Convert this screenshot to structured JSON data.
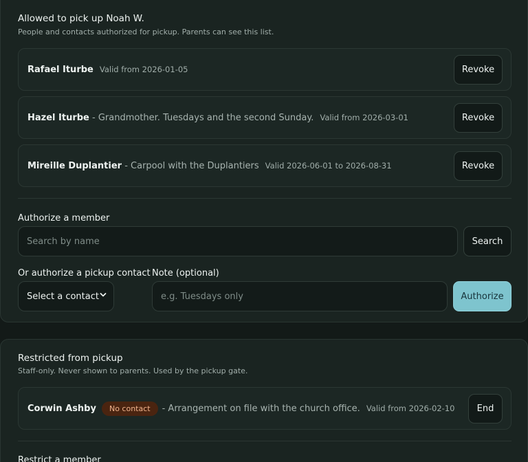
{
  "allowed": {
    "title": "Allowed to pick up Noah W.",
    "subtitle": "People and contacts authorized for pickup. Parents can see this list.",
    "rows": [
      {
        "name": "Rafael Iturbe",
        "separator": "",
        "description": "",
        "valid": "Valid from 2026-01-05",
        "action": "Revoke"
      },
      {
        "name": "Hazel Iturbe",
        "separator": " - ",
        "description": "Grandmother. Tuesdays and the second Sunday.",
        "valid": "Valid from 2026-03-01",
        "action": "Revoke"
      },
      {
        "name": "Mireille Duplantier",
        "separator": " - ",
        "description": "Carpool with the Duplantiers",
        "valid": "Valid 2026-06-01 to 2026-08-31",
        "action": "Revoke"
      }
    ],
    "authorize_member": {
      "label": "Authorize a member",
      "search_placeholder": "Search by name",
      "search_button": "Search"
    },
    "authorize_contact": {
      "label": "Or authorize a pickup contact",
      "select_value": "Select a contact",
      "note_label": "Note (optional)",
      "note_placeholder": "e.g. Tuesdays only",
      "authorize_button": "Authorize"
    }
  },
  "restricted": {
    "title": "Restricted from pickup",
    "subtitle": "Staff-only. Never shown to parents. Used by the pickup gate.",
    "rows": [
      {
        "name": "Corwin Ashby",
        "badge": "No contact",
        "separator": "- ",
        "description": "Arrangement on file with the church office.",
        "valid": "Valid from 2026-02-10",
        "action": "End"
      }
    ],
    "restrict_member_label": "Restrict a member"
  },
  "colors": {
    "primary": "#7ec4ce",
    "badge_bg": "#4a2410",
    "badge_text": "#f1b38c"
  },
  "icons": [
    "chevron-down-icon"
  ]
}
